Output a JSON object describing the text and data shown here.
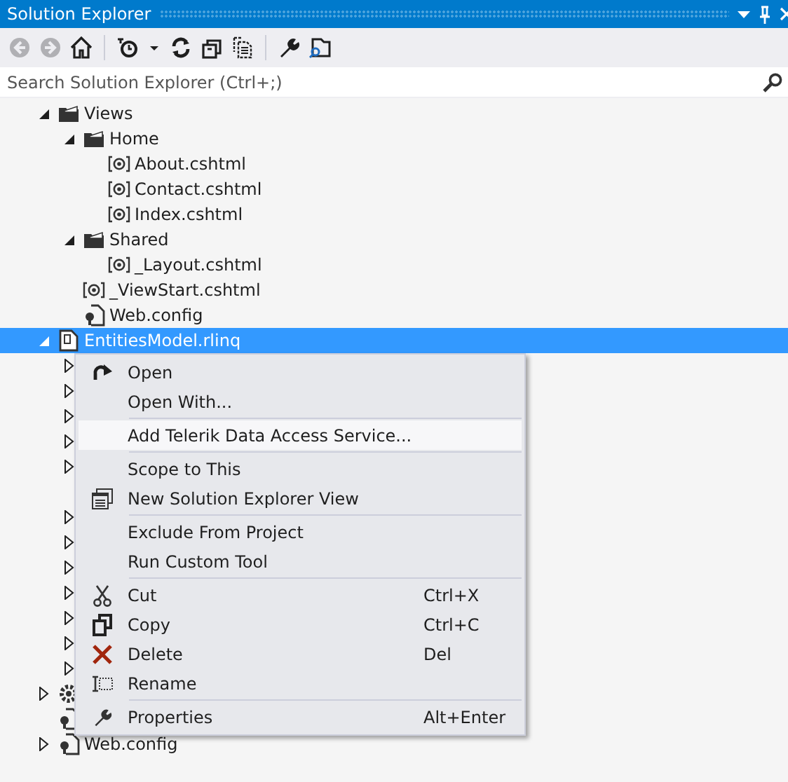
{
  "window": {
    "title": "Solution Explorer"
  },
  "toolbar": [
    {
      "kind": "back",
      "disabled": true
    },
    {
      "kind": "forward",
      "disabled": true
    },
    {
      "kind": "home",
      "disabled": false
    },
    {
      "kind": "separator"
    },
    {
      "kind": "history",
      "disabled": false
    },
    {
      "kind": "caret",
      "disabled": false
    },
    {
      "kind": "refresh",
      "disabled": false
    },
    {
      "kind": "collapse",
      "disabled": false
    },
    {
      "kind": "files",
      "disabled": false
    },
    {
      "kind": "separator"
    },
    {
      "kind": "wrench",
      "disabled": false
    },
    {
      "kind": "preview",
      "disabled": false
    }
  ],
  "search": {
    "placeholder": "Search Solution Explorer (Ctrl+;)"
  },
  "tree": [
    {
      "label": "Views",
      "kind": "folder",
      "expanded": true,
      "selected": false,
      "children": [
        {
          "label": "Home",
          "kind": "folder",
          "expanded": true,
          "selected": false,
          "children": [
            {
              "label": "About.cshtml",
              "kind": "razor",
              "selected": false
            },
            {
              "label": "Contact.cshtml",
              "kind": "razor",
              "selected": false
            },
            {
              "label": "Index.cshtml",
              "kind": "razor",
              "selected": false
            }
          ]
        },
        {
          "label": "Shared",
          "kind": "folder",
          "expanded": true,
          "selected": false,
          "children": [
            {
              "label": "_Layout.cshtml",
              "kind": "razor",
              "selected": false
            }
          ]
        },
        {
          "label": "_ViewStart.cshtml",
          "kind": "razor",
          "selected": false
        },
        {
          "label": "Web.config",
          "kind": "config",
          "selected": false
        }
      ]
    },
    {
      "label": "EntitiesModel.rlinq",
      "kind": "model",
      "expanded": true,
      "selected": true,
      "children": [
        {
          "kind": "hidden",
          "expanded": false,
          "selected": false
        },
        {
          "kind": "hidden",
          "expanded": false,
          "selected": false
        },
        {
          "kind": "hidden",
          "expanded": false,
          "selected": false
        },
        {
          "kind": "hidden",
          "expanded": false,
          "selected": false
        },
        {
          "kind": "hidden",
          "expanded": false,
          "selected": false
        },
        {
          "kind": "hidden",
          "selected": false
        },
        {
          "kind": "hidden",
          "expanded": false,
          "selected": false
        },
        {
          "kind": "hidden",
          "expanded": false,
          "selected": false
        },
        {
          "kind": "hidden",
          "expanded": false,
          "selected": false
        },
        {
          "kind": "hidden",
          "expanded": false,
          "selected": false
        },
        {
          "kind": "hidden",
          "expanded": false,
          "selected": false
        },
        {
          "kind": "hidden",
          "expanded": false,
          "selected": false
        },
        {
          "kind": "hidden",
          "expanded": false,
          "selected": false
        }
      ]
    },
    {
      "kind": "gear",
      "expanded": false,
      "selected": false
    },
    {
      "kind": "config",
      "selected": false
    },
    {
      "label": "Web.config",
      "kind": "config",
      "expanded": false,
      "selected": false
    }
  ],
  "context_menu": [
    {
      "kind": "redo",
      "label": "Open",
      "highlighted": false
    },
    {
      "kind": "plain",
      "label": "Open With...",
      "highlighted": false
    },
    {
      "kind": "separator"
    },
    {
      "kind": "plain",
      "label": "Add Telerik Data Access Service...",
      "highlighted": true
    },
    {
      "kind": "separator"
    },
    {
      "kind": "plain",
      "label": "Scope to This",
      "highlighted": false
    },
    {
      "kind": "window",
      "label": "New Solution Explorer View",
      "highlighted": false
    },
    {
      "kind": "separator"
    },
    {
      "kind": "plain",
      "label": "Exclude From Project",
      "highlighted": false
    },
    {
      "kind": "plain",
      "label": "Run Custom Tool",
      "highlighted": false
    },
    {
      "kind": "separator"
    },
    {
      "kind": "cut",
      "label": "Cut",
      "shortcut": "Ctrl+X",
      "highlighted": false
    },
    {
      "kind": "copy",
      "label": "Copy",
      "shortcut": "Ctrl+C",
      "highlighted": false
    },
    {
      "kind": "delete",
      "label": "Delete",
      "shortcut": "Del",
      "highlighted": false
    },
    {
      "kind": "rename",
      "label": "Rename",
      "highlighted": false
    },
    {
      "kind": "separator"
    },
    {
      "kind": "wrench",
      "label": "Properties",
      "shortcut": "Alt+Enter",
      "highlighted": false
    }
  ]
}
